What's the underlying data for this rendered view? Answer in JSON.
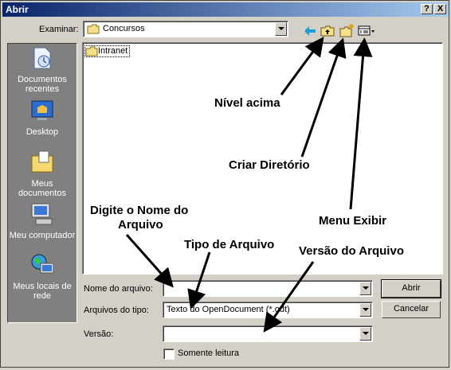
{
  "window": {
    "title": "Abrir",
    "help_button": "?",
    "close_button": "X"
  },
  "lookin": {
    "label": "Examinar:",
    "value": "Concursos"
  },
  "toolbar": {
    "back_icon": "back-arrow-icon",
    "up_icon": "up-folder-icon",
    "new_folder_icon": "new-folder-icon",
    "views_icon": "views-menu-icon"
  },
  "places": [
    {
      "label": "Documentos recentes",
      "icon": "recent-documents-icon"
    },
    {
      "label": "Desktop",
      "icon": "desktop-icon"
    },
    {
      "label": "Meus documentos",
      "icon": "my-documents-icon"
    },
    {
      "label": "Meu computador",
      "icon": "my-computer-icon"
    },
    {
      "label": "Meus locais de rede",
      "icon": "network-places-icon"
    }
  ],
  "files": [
    {
      "name": "Intranet",
      "icon": "folder-icon"
    }
  ],
  "form": {
    "filename_label": "Nome do arquivo:",
    "filename_value": "",
    "filetype_label": "Arquivos do tipo:",
    "filetype_value": "Texto do OpenDocument (*.odt)",
    "version_label": "Versão:",
    "version_value": "",
    "readonly_label": "Somente leitura",
    "readonly_checked": false
  },
  "buttons": {
    "open": "Abrir",
    "cancel": "Cancelar"
  },
  "annotations": {
    "up_level": "Nível acima",
    "create_dir": "Criar Diretório",
    "view_menu": "Menu Exibir",
    "type_name_1": "Digite o Nome do",
    "type_name_2": "Arquivo",
    "file_type": "Tipo de Arquivo",
    "file_version": "Versão do Arquivo"
  }
}
